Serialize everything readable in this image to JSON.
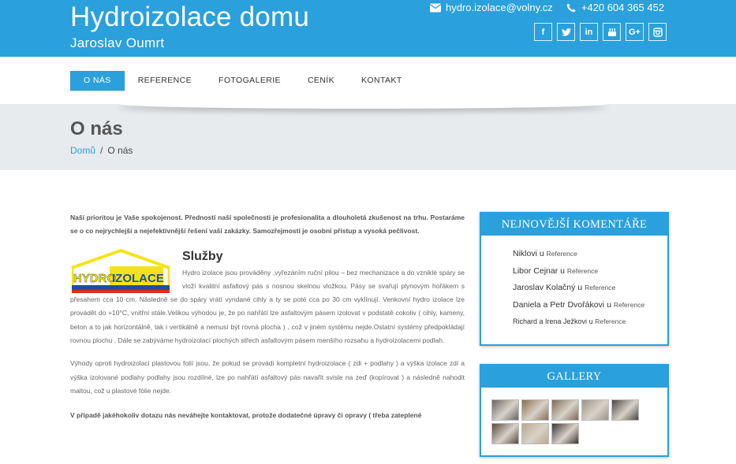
{
  "header": {
    "title": "Hydroizolace domu",
    "subtitle": "Jaroslav Oumrt",
    "email": "hydro.izolace@volny.cz",
    "phone": "+420 604 365 452",
    "social": [
      "f",
      "t",
      "in",
      "yt",
      "G+",
      "ig"
    ]
  },
  "nav": {
    "items": [
      "O NÁS",
      "REFERENCE",
      "FOTOGALERIE",
      "CENÍK",
      "KONTAKT"
    ],
    "active": "O NÁS"
  },
  "hero": {
    "title": "O nás",
    "breadcrumb_home": "Domů",
    "breadcrumb_sep": "/",
    "breadcrumb_current": "O nás"
  },
  "content": {
    "lead": "Naší prioritou je Vaše spokojenost. Předností naší společnosti je profesionalita a dlouholetá zkušenost na trhu. Postaráme se o co nejrychlejší a nejefektivnější řešení vaší zakázky. Samozřejmostí je osobní přístup a vysoká pečlivost.",
    "logo_text_left": "HYDRO",
    "logo_text_right": "IZOLACE",
    "services_title": "Služby",
    "services_text": "Hydro izolace  jsou prováděny ,vyřezáním ruční pilou – bez mechanizace a do vzniklé spáry se vloží kvalitní asfaltový pás s nosnou skelnou vložkou. Pásy se svařují plynovým hořákem s přesahem cca 10 cm. Následně se do spáry vrátí vyndané cihly a ty se poté cca po 30 cm vyklínují. Venkovní hydro izolace  lze provádět do +10°C, vnitřní stále.Velikou výhodou je, že po nahřátí lze asfaltovým pásem izolovat v podstatě cokoliv ( cihly, kameny, beton a to jak horizontálně, tak i vertikálně  a nemusí být rovná plocha ) , což v jiném systému nejde.Ostatní systémy předpokládají rovnou plochu . Dále se zabýváme hydroizolací plochých střech asfaltovým pásem  menšího rozsahu a hydroizolacemi podlah.",
    "advantages_text": "Výhody oproti hydroizolaci plastovou folií jsou, že pokud se provádí kompletní hydroizolace ( zdi + podlahy ) a výška izolace zdí a výška izolované podlahy podlahy jsou rozdílné, lze po nahřátí asfaltový pás navařit svisle na zeď   (kopírovat ) a následně nahodit maltou, což u plastové fólie nejde.",
    "contact_note": " V případě jakéhokoliv dotazu nás neváhejte kontaktovat, protože dodatečné úpravy či opravy ( třeba zateplené"
  },
  "comments_widget": {
    "title": "NEJNOVĚJŠÍ KOMENTÁŘE",
    "items": [
      {
        "author": "Niklovi",
        "on": "u",
        "post": "Reference"
      },
      {
        "author": "Libor Cejnar",
        "on": "u",
        "post": "Reference"
      },
      {
        "author": "Jaroslav Kolačný",
        "on": "u",
        "post": "Reference"
      },
      {
        "author": "Daniela a Petr Dvořákovi",
        "on": "u",
        "post": "Reference"
      },
      {
        "author": "Richard a Irena Ježkovi",
        "on": "u",
        "post": "Reference"
      }
    ]
  },
  "gallery_widget": {
    "title": "GALLERY",
    "thumbs": [
      "#6a6460",
      "#8a6e55",
      "#7d6a58",
      "#9a948c",
      "#4a4644",
      "#5a4a3e",
      "#b8a890",
      "#3a3634"
    ]
  },
  "colors": {
    "brand": "#2aa0dc",
    "hero_bg": "#e8ebee",
    "logo_yellow": "#f5e31a",
    "logo_blue": "#1d4fa0",
    "logo_red": "#e22b1b"
  }
}
